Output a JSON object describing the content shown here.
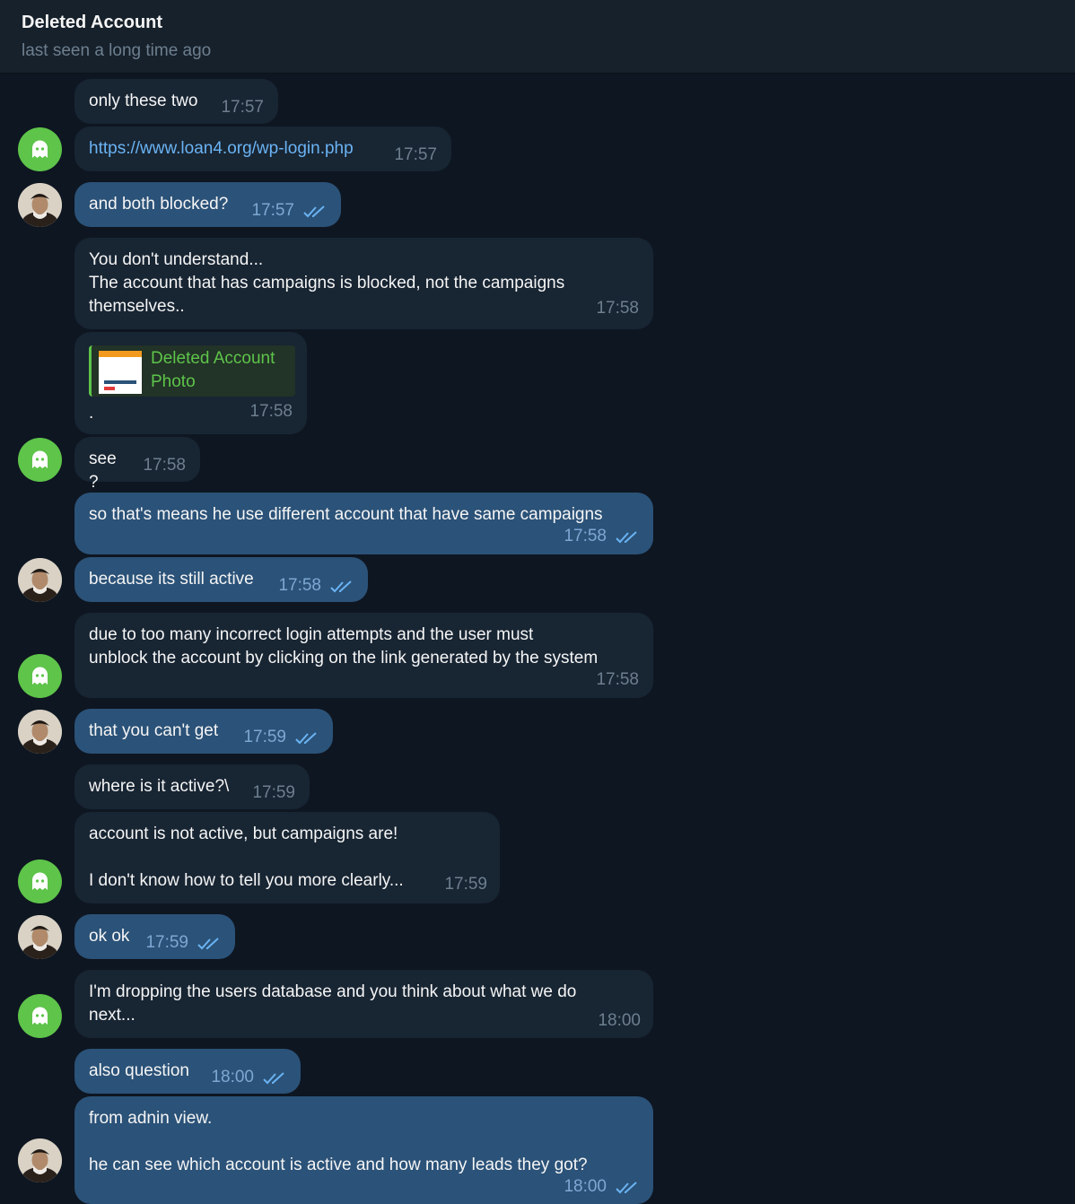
{
  "header": {
    "title": "Deleted Account",
    "status": "last seen a long time ago"
  },
  "messages": [
    {
      "text": "only these two",
      "time": "17:57"
    },
    {
      "text": "https://www.loan4.org/wp-login.php",
      "time": "17:57"
    },
    {
      "text": "and both blocked?",
      "time": "17:57"
    },
    {
      "text": "You don't understand...\nThe account that has campaigns is blocked, not the campaigns\nthemselves..",
      "time": "17:58"
    },
    {
      "text": ".",
      "time": "17:58",
      "reply_name": "Deleted Account",
      "reply_type": "Photo"
    },
    {
      "text": "see ?",
      "time": "17:58"
    },
    {
      "text": "so that's means he use different account that have same campaigns",
      "time": "17:58"
    },
    {
      "text": "because its still active",
      "time": "17:58"
    },
    {
      "text": "due to too many incorrect login attempts and the user must\nunblock the account by clicking on the link generated by the system",
      "time": "17:58"
    },
    {
      "text": "that you can't get",
      "time": "17:59"
    },
    {
      "text": "where is it active?\\",
      "time": "17:59"
    },
    {
      "text": "account is not active, but campaigns are!\n\nI don't know how to tell you more clearly...",
      "time": "17:59"
    },
    {
      "text": "ok ok",
      "time": "17:59"
    },
    {
      "text": "I'm dropping the users database and you think about what we do\nnext...",
      "time": "18:00"
    },
    {
      "text": "also question",
      "time": "18:00"
    },
    {
      "text": "from adnin view.\n\nhe can see which account is active and how many leads they got?",
      "time": "18:00"
    }
  ],
  "colors": {
    "background": "#0e1621",
    "incoming_bubble": "#182533",
    "outgoing_bubble": "#2b5278",
    "link": "#6ab3f3",
    "ghost_avatar": "#5ec44a"
  }
}
